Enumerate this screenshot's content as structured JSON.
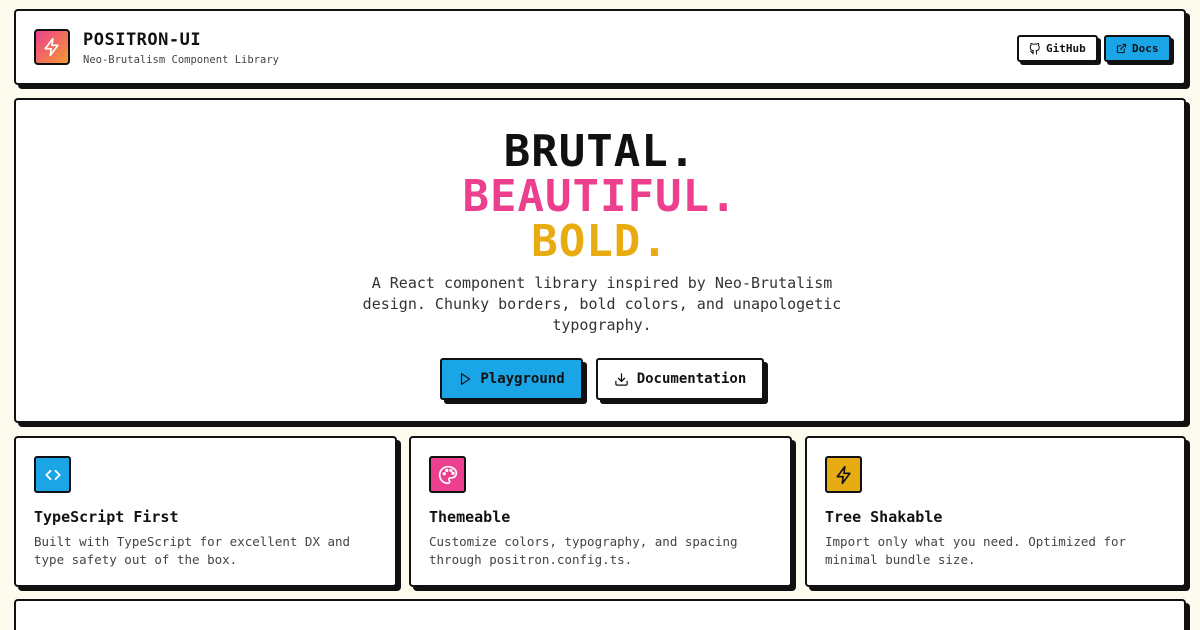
{
  "header": {
    "title": "POSITRON-UI",
    "subtitle": "Neo-Brutalism Component Library",
    "github_label": "GitHub",
    "docs_label": "Docs",
    "logo_icon": "lightning-icon"
  },
  "hero": {
    "line1": "BRUTAL.",
    "line2": "BEAUTIFUL.",
    "line3": "BOLD.",
    "description": "A React component library inspired by Neo-Brutalism design. Chunky borders, bold colors, and unapologetic typography.",
    "playground_label": "Playground",
    "documentation_label": "Documentation"
  },
  "features": [
    {
      "title": "TypeScript First",
      "description": "Built with TypeScript for excellent DX and type safety out of the box.",
      "icon": "code-icon",
      "color": "#1aa5e6"
    },
    {
      "title": "Themeable",
      "description": "Customize colors, typography, and spacing through positron.config.ts.",
      "icon": "palette-icon",
      "color": "#ec3f8e"
    },
    {
      "title": "Tree Shakable",
      "description": "Import only what you need. Optimized for minimal bundle size.",
      "icon": "lightning-icon",
      "color": "#e8ac12"
    }
  ],
  "colors": {
    "accent_blue": "#1aa5e6",
    "accent_pink": "#ec3f8e",
    "accent_yellow": "#e8ac12",
    "background": "#fdfbee",
    "border": "#111111"
  }
}
